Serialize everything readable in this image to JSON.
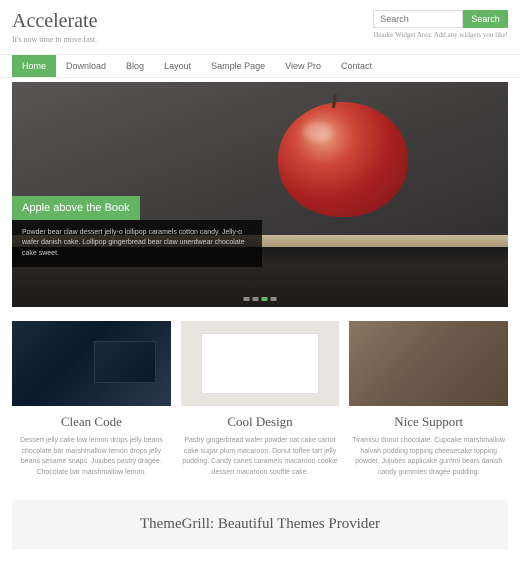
{
  "header": {
    "title": "Accelerate",
    "tagline": "It's now time to move fast.",
    "search_placeholder": "Search",
    "search_button": "Search",
    "widget_note": "Header Widget Area: Add any widgets you like!"
  },
  "nav": {
    "items": [
      "Home",
      "Download",
      "Blog",
      "Layout",
      "Sample Page",
      "View Pro",
      "Contact"
    ],
    "active_index": 0
  },
  "hero": {
    "caption_title": "Apple above the Book",
    "caption_text": "Powder bear claw dessert jelly-o lollipop caramels cotton candy. Jelly-o wafer danish cake. Lollipop gingerbread bear claw unerdwear chocolate cake sweet."
  },
  "features": [
    {
      "title": "Clean Code",
      "text": "Dessert jelly cake low lemon drops jelly beans chocolate bar marshmallow lemon drops jelly beans sesame snaps. Jujubes pastry dragée. Chocolate bar marshmallow lemon."
    },
    {
      "title": "Cool Design",
      "text": "Pastry gingerbread wafer powder oat cake carrot cake sugar plum macaroon. Donut toffee tart jelly pudding. Candy canes caramels macaroon cookie dessert macaroon soufflé cake."
    },
    {
      "title": "Nice Support",
      "text": "Tiramisu donut chocolate. Cupcake marshmallow halvah pudding topping cheesecake topping powder. Jujubes applicake gummi bears danish candy gummies dragée pudding."
    }
  ],
  "footer": {
    "banner_title": "ThemeGrill: Beautiful Themes Provider"
  }
}
